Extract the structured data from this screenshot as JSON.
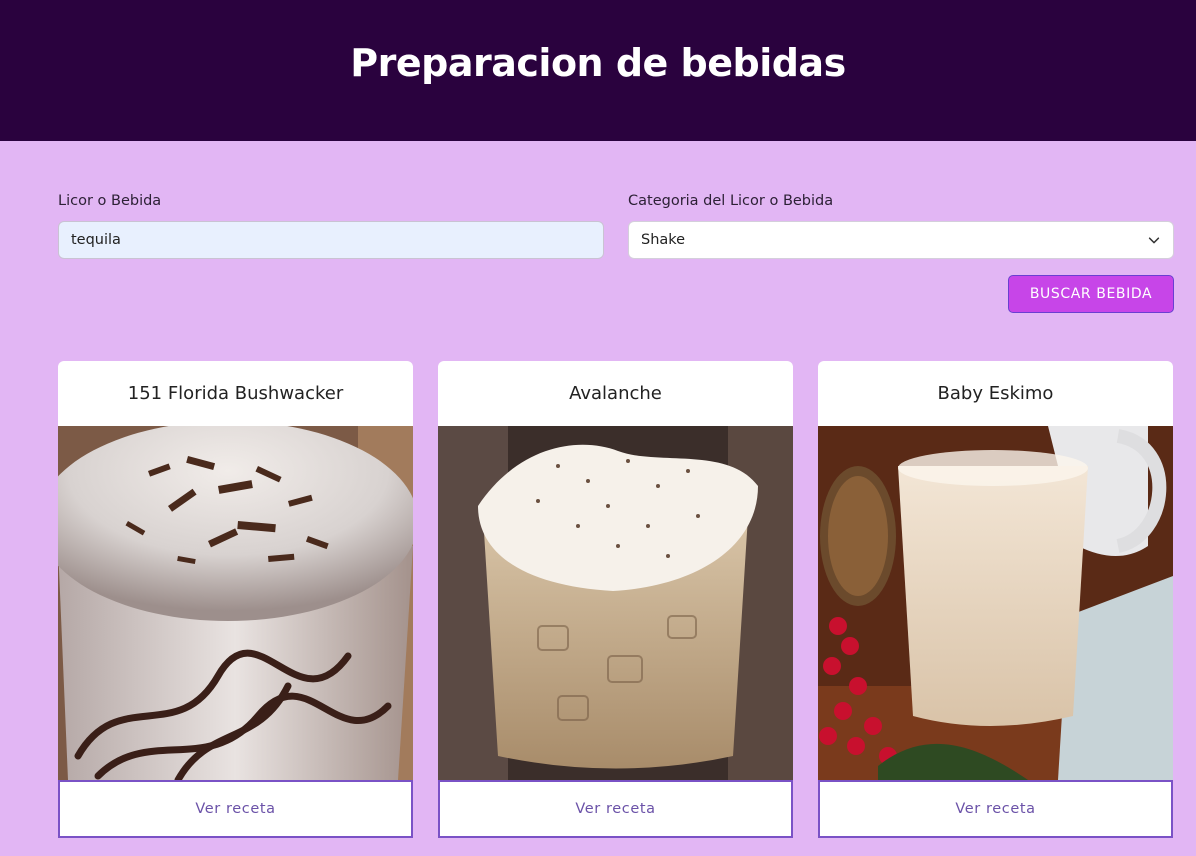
{
  "header": {
    "title": "Preparacion de bebidas"
  },
  "form": {
    "name_label": "Licor o Bebida",
    "name_value": "tequila",
    "category_label": "Categoria del Licor o Bebida",
    "category_value": "Shake",
    "search_button": "BUSCAR BEBIDA"
  },
  "cards": [
    {
      "title": "151 Florida Bushwacker",
      "button": "Ver receta"
    },
    {
      "title": "Avalanche",
      "button": "Ver receta"
    },
    {
      "title": "Baby Eskimo",
      "button": "Ver receta"
    }
  ],
  "colors": {
    "header_bg": "#2a023e",
    "page_bg": "#e2b6f4",
    "button_bg": "#c745e8",
    "card_border": "#7a52c6"
  }
}
